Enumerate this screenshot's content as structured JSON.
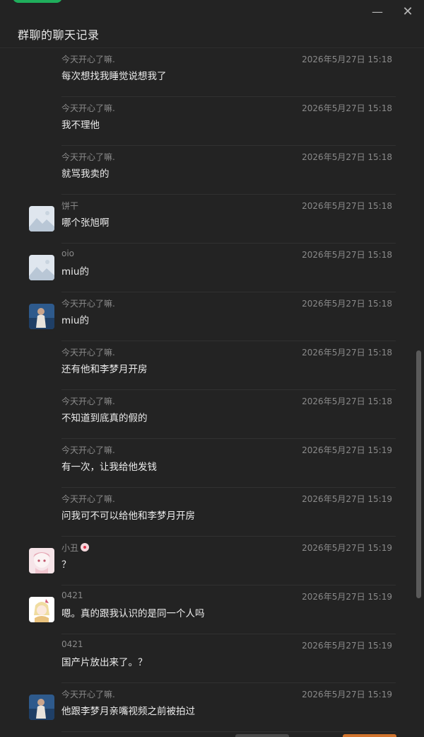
{
  "window": {
    "title": "群聊的聊天记录",
    "min_glyph": "—",
    "close_glyph": "✕"
  },
  "colors": {
    "background": "#232323",
    "accent_green": "#1fae5c",
    "accent_orange": "#d0732d"
  },
  "messages": [
    {
      "sender": "今天开心了嘛.",
      "time": "2026年5月27日 15:18",
      "text": "每次想找我睡觉说想我了",
      "avatar": ""
    },
    {
      "sender": "今天开心了嘛.",
      "time": "2026年5月27日 15:18",
      "text": "我不理他",
      "avatar": ""
    },
    {
      "sender": "今天开心了嘛.",
      "time": "2026年5月27日 15:18",
      "text": "就骂我卖的",
      "avatar": ""
    },
    {
      "sender": "饼干",
      "time": "2026年5月27日 15:18",
      "text": "哪个张旭啊",
      "avatar": "placeholder-image-icon"
    },
    {
      "sender": "oio",
      "time": "2026年5月27日 15:18",
      "text": "miu的",
      "avatar": "placeholder-image-icon"
    },
    {
      "sender": "今天开心了嘛.",
      "time": "2026年5月27日 15:18",
      "text": "miu的",
      "avatar": "photo-avatar-icon"
    },
    {
      "sender": "今天开心了嘛.",
      "time": "2026年5月27日 15:18",
      "text": "还有他和李梦月开房",
      "avatar": ""
    },
    {
      "sender": "今天开心了嘛.",
      "time": "2026年5月27日 15:18",
      "text": "不知道到底真的假的",
      "avatar": ""
    },
    {
      "sender": "今天开心了嘛.",
      "time": "2026年5月27日 15:19",
      "text": "有一次，让我给他发钱",
      "avatar": ""
    },
    {
      "sender": "今天开心了嘛.",
      "time": "2026年5月27日 15:19",
      "text": "问我可不可以给他和李梦月开房",
      "avatar": ""
    },
    {
      "sender": "小丑",
      "time": "2026年5月27日 15:19",
      "text": "？",
      "avatar": "anime-avatar-icon",
      "sender_emoji": "clown-emoji-icon"
    },
    {
      "sender": "0421",
      "time": "2026年5月27日 15:19",
      "text": "嗯。真的跟我认识的是同一个人吗",
      "avatar": "anime-avatar-icon"
    },
    {
      "sender": "0421",
      "time": "2026年5月27日 15:19",
      "text": "国产片放出来了。？",
      "avatar": ""
    },
    {
      "sender": "今天开心了嘛.",
      "time": "2026年5月27日 15:19",
      "text": "他跟李梦月亲嘴视频之前被拍过",
      "avatar": "photo-avatar-icon"
    }
  ]
}
